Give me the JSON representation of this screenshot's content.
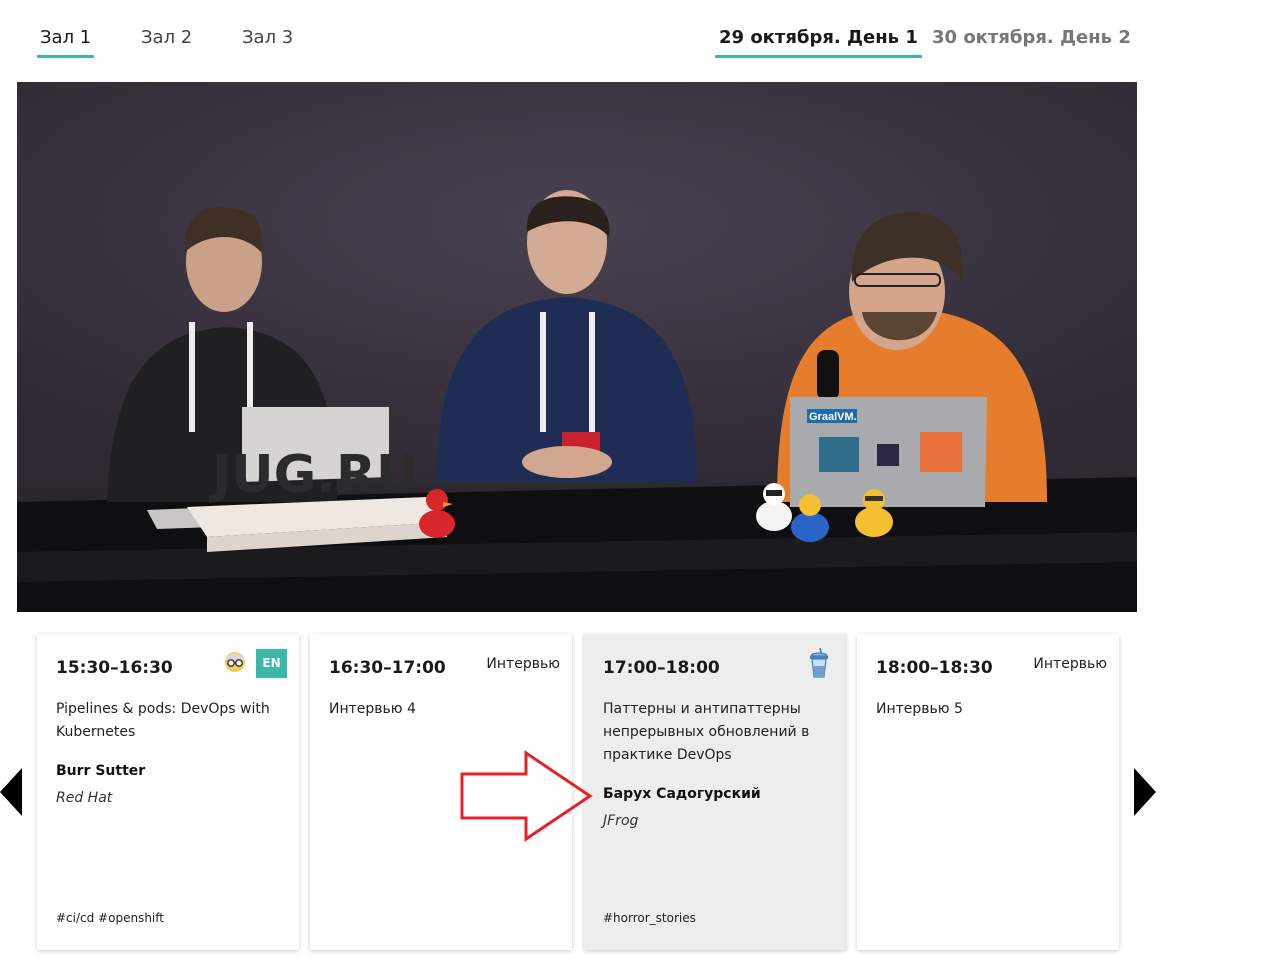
{
  "halls": [
    {
      "label": "Зал 1",
      "active": true
    },
    {
      "label": "Зал 2",
      "active": false
    },
    {
      "label": "Зал 3",
      "active": false
    }
  ],
  "days": [
    {
      "label": "29 октября. День 1",
      "active": true
    },
    {
      "label": "30 октября. День 2",
      "active": false
    }
  ],
  "video": {
    "logo_text": "JUG.RU",
    "laptop_brand": "GraalVM."
  },
  "cards": [
    {
      "time": "15:30–16:30",
      "title": "Pipelines & pods: DevOps with Kubernetes",
      "speaker": "Burr Sutter",
      "company": "Red Hat",
      "tags": "#ci/cd #openshift",
      "lang": "EN",
      "icon": "nerd-glasses-icon"
    },
    {
      "time": "16:30–17:00",
      "kind": "Интервью",
      "title": "Интервью 4"
    },
    {
      "time": "17:00–18:00",
      "title": "Паттерны и антипаттерны непрерывных обновлений в практике DevOps",
      "speaker": "Барух Садогурский",
      "company": "JFrog",
      "tags": "#horror_stories",
      "icon": "drink-cup-icon",
      "current": true
    },
    {
      "time": "18:00–18:30",
      "kind": "Интервью",
      "title": "Интервью 5"
    }
  ],
  "colors": {
    "accent": "#3cb8a7",
    "annotation": "#e0242a",
    "current_card": "#ededed"
  }
}
